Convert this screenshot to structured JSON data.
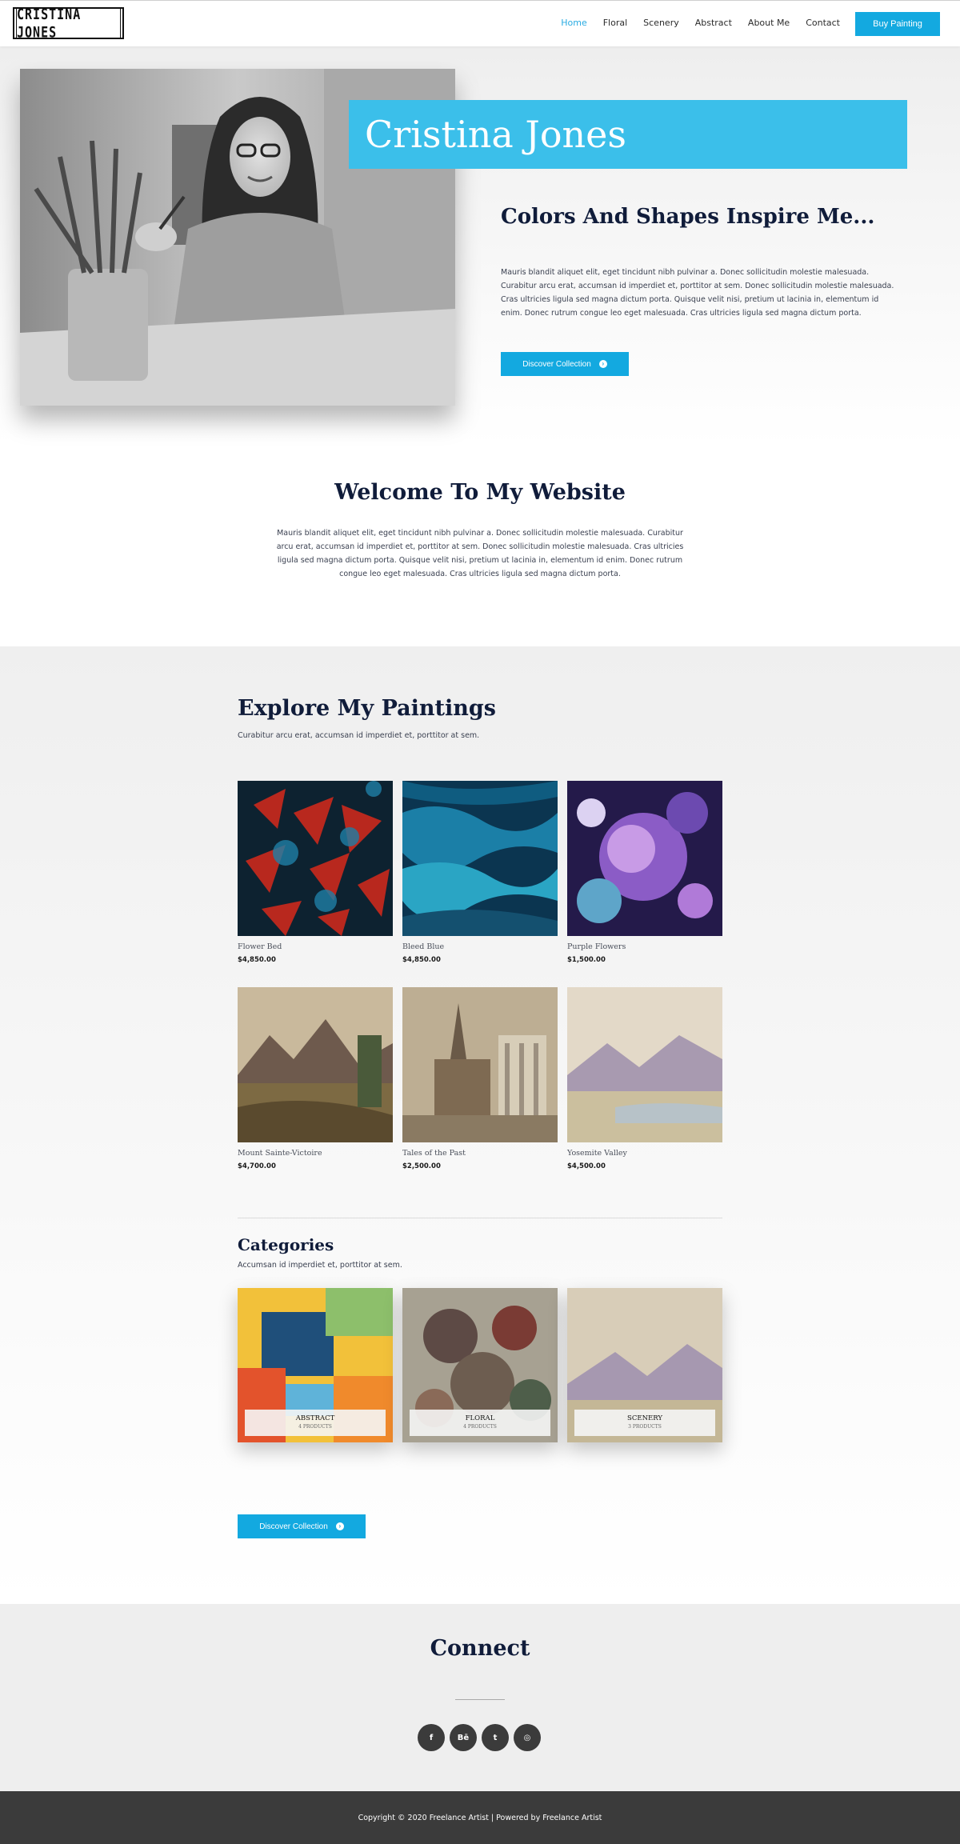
{
  "header": {
    "logo_text": "CRISTINA JONES",
    "nav": [
      {
        "label": "Home",
        "active": true
      },
      {
        "label": "Floral",
        "active": false
      },
      {
        "label": "Scenery",
        "active": false
      },
      {
        "label": "Abstract",
        "active": false
      },
      {
        "label": "About Me",
        "active": false
      },
      {
        "label": "Contact",
        "active": false
      }
    ],
    "buy_label": "Buy Painting"
  },
  "hero": {
    "name": "Cristina Jones",
    "tagline": "Colors And Shapes Inspire Me...",
    "text": "Mauris blandit aliquet elit, eget tincidunt nibh pulvinar a. Donec sollicitudin molestie malesuada. Curabitur arcu erat, accumsan id imperdiet et, porttitor at sem. Donec sollicitudin molestie malesuada. Cras ultricies ligula sed magna dictum porta. Quisque velit nisi, pretium ut lacinia in, elementum id enim. Donec rutrum congue leo eget malesuada. Cras ultricies ligula sed magna dictum porta.",
    "button_label": "Discover Collection"
  },
  "welcome": {
    "title": "Welcome To My Website",
    "text": "Mauris blandit aliquet elit, eget tincidunt nibh pulvinar a. Donec sollicitudin molestie malesuada. Curabitur arcu erat, accumsan id imperdiet et, porttitor at sem. Donec sollicitudin molestie malesuada. Cras ultricies ligula sed magna dictum porta. Quisque velit nisi, pretium ut lacinia in, elementum id enim. Donec rutrum congue leo eget malesuada. Cras ultricies ligula sed magna dictum porta."
  },
  "explore": {
    "title": "Explore My Paintings",
    "subtitle": "Curabitur arcu erat, accumsan id imperdiet et, porttitor at sem.",
    "paintings": [
      {
        "title": "Flower Bed",
        "price": "$4,850.00"
      },
      {
        "title": "Bleed Blue",
        "price": "$4,850.00"
      },
      {
        "title": "Purple Flowers",
        "price": "$1,500.00"
      },
      {
        "title": "Mount Sainte-Victoire",
        "price": "$4,700.00"
      },
      {
        "title": "Tales of the Past",
        "price": "$2,500.00"
      },
      {
        "title": "Yosemite Valley",
        "price": "$4,500.00"
      }
    ]
  },
  "categories": {
    "title": "Categories",
    "subtitle": "Accumsan id imperdiet et, porttitor at sem.",
    "items": [
      {
        "name": "ABSTRACT",
        "count": "4 PRODUCTS"
      },
      {
        "name": "FLORAL",
        "count": "4 PRODUCTS"
      },
      {
        "name": "SCENERY",
        "count": "3 PRODUCTS"
      }
    ],
    "button_label": "Discover Collection"
  },
  "connect": {
    "title": "Connect",
    "socials": [
      {
        "icon": "facebook-icon",
        "glyph": "f"
      },
      {
        "icon": "behance-icon",
        "glyph": "Bē"
      },
      {
        "icon": "twitter-icon",
        "glyph": "t"
      },
      {
        "icon": "instagram-icon",
        "glyph": "◎"
      }
    ]
  },
  "footer": {
    "copyright": "Copyright © 2020 Freelance Artist | Powered by Freelance Artist"
  },
  "colors": {
    "accent": "#13a9e0",
    "hero_name_bg": "#3bbfea",
    "heading": "#101c3a",
    "footer_bg": "#3b3b3b"
  }
}
